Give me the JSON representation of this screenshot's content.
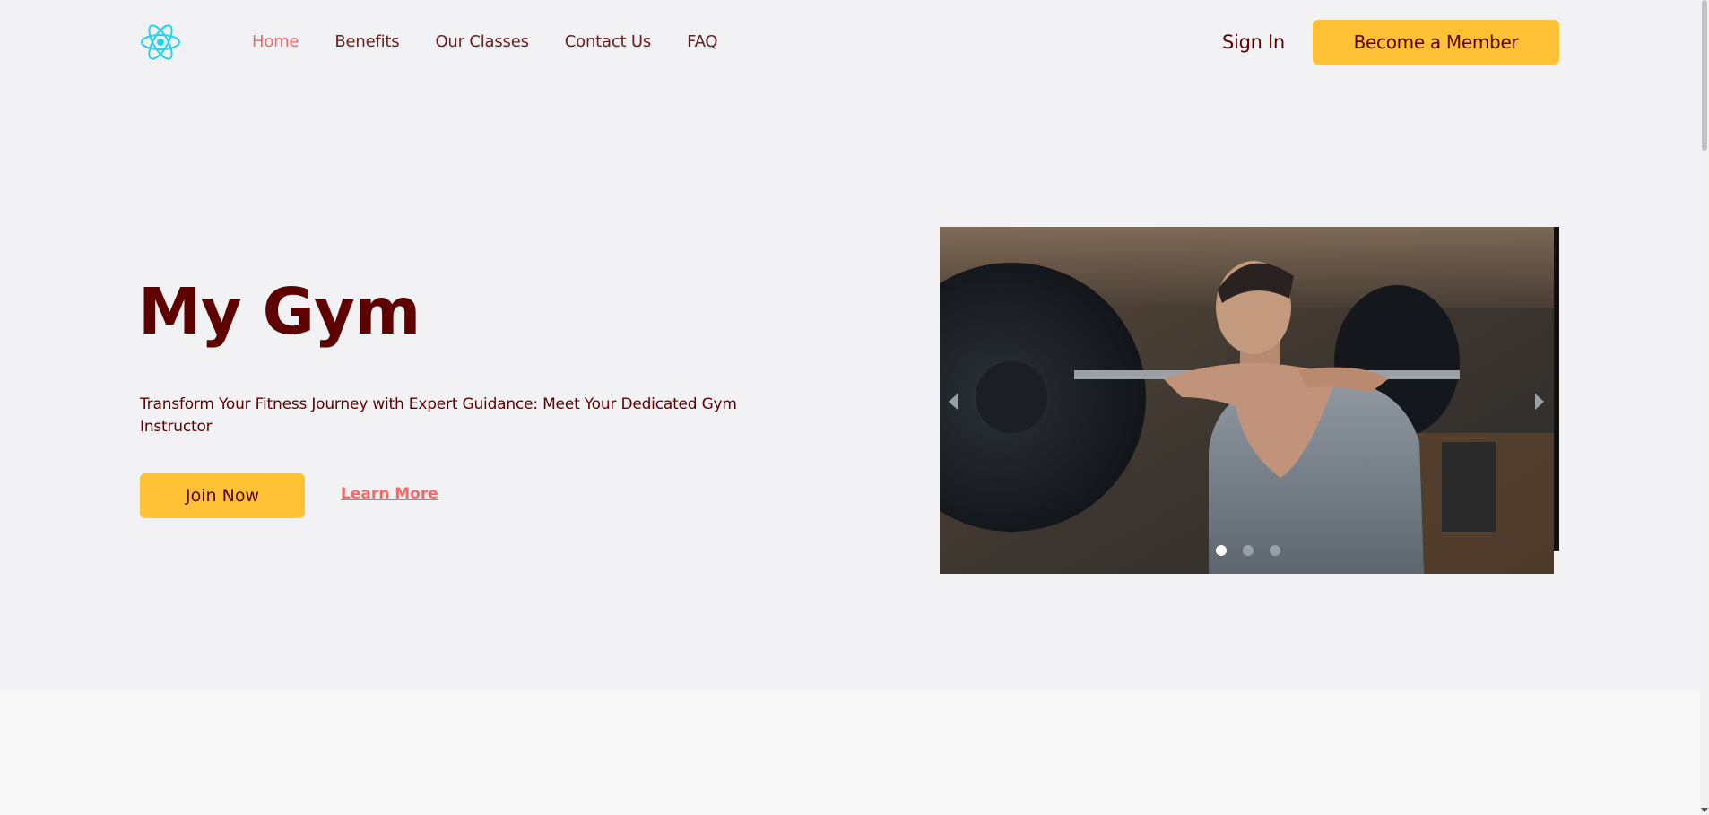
{
  "nav": {
    "logo_icon": "react-atom-icon",
    "logo_color": "#22d3ee",
    "links": [
      {
        "label": "Home",
        "active": true
      },
      {
        "label": "Benefits",
        "active": false
      },
      {
        "label": "Our Classes",
        "active": false
      },
      {
        "label": "Contact Us",
        "active": false
      },
      {
        "label": "FAQ",
        "active": false
      }
    ],
    "sign_in": "Sign In",
    "member_button": "Become a Member"
  },
  "hero": {
    "title": "My Gym",
    "text": "Transform Your Fitness Journey with Expert Guidance: Meet Your Dedicated Gym Instructor",
    "join_button": "Join Now",
    "learn_more": "Learn More"
  },
  "carousel": {
    "slide_count": 3,
    "active_slide": 1,
    "prev_icon": "chevron-left-icon",
    "next_icon": "chevron-right-icon"
  },
  "colors": {
    "accent": "#ffc136",
    "primary_text": "#5e0000",
    "link_active": "#ef6a6a",
    "background": "#f2f1f4"
  }
}
